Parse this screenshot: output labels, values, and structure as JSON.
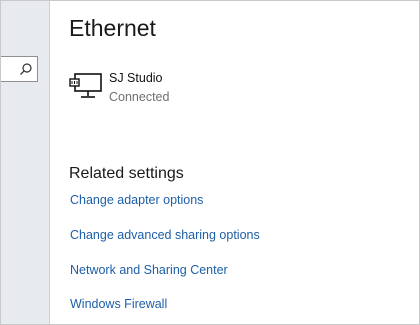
{
  "page": {
    "title": "Ethernet"
  },
  "network": {
    "name": "SJ Studio",
    "status": "Connected",
    "icon": "ethernet-monitor-icon"
  },
  "search": {
    "icon": "search-icon"
  },
  "related": {
    "heading": "Related settings",
    "links": [
      {
        "label": "Change adapter options"
      },
      {
        "label": "Change advanced sharing options"
      },
      {
        "label": "Network and Sharing Center"
      },
      {
        "label": "Windows Firewall"
      }
    ]
  },
  "colors": {
    "link": "#1d5fa8",
    "left_pane": "#e7ebf0"
  }
}
